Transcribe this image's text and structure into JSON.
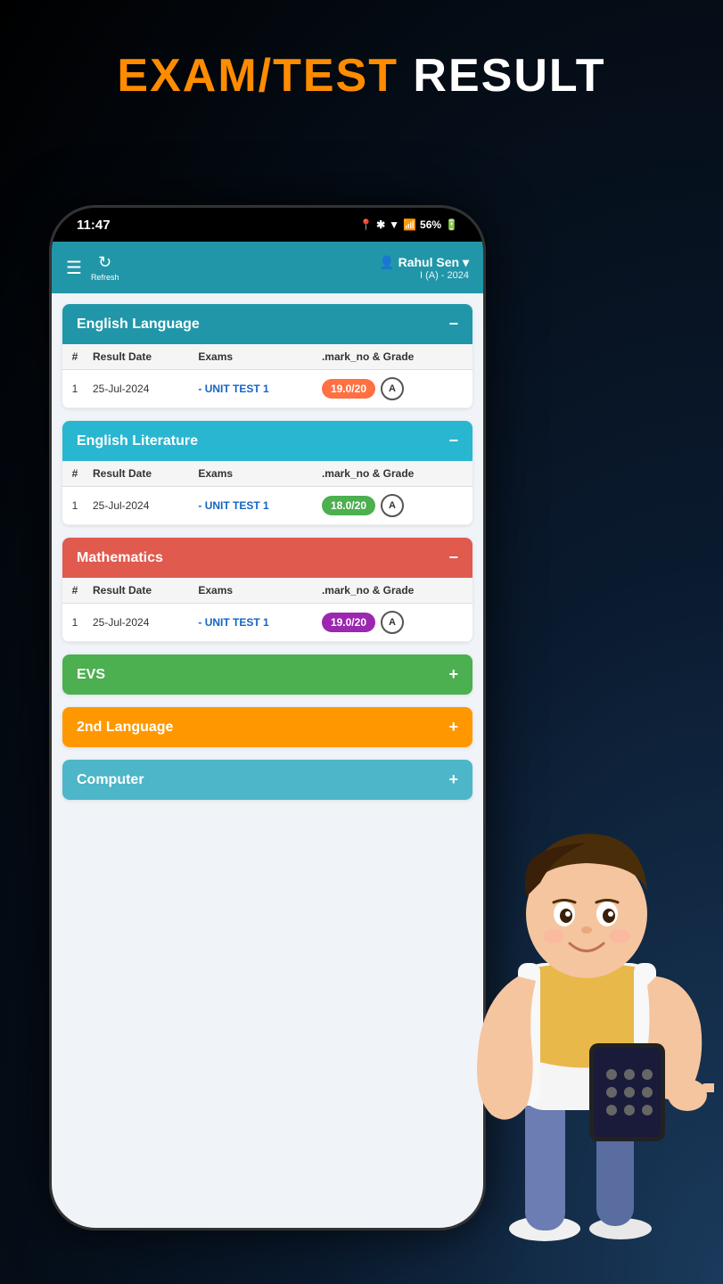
{
  "page": {
    "title_orange": "EXAM/TEST",
    "title_white": " RESULT"
  },
  "status_bar": {
    "time": "11:47",
    "battery": "56%"
  },
  "header": {
    "refresh_label": "Refresh",
    "user_icon": "👤",
    "user_name": "Rahul Sen",
    "user_class": "I (A) - 2024"
  },
  "subjects": [
    {
      "id": "english-language",
      "name": "English Language",
      "color": "blue",
      "toggle": "−",
      "expanded": true,
      "columns": [
        "#",
        "Result Date",
        "Exams",
        ".mark_no & Grade"
      ],
      "rows": [
        {
          "num": 1,
          "date": "25-Jul-2024",
          "exam": "- UNIT TEST 1",
          "marks": "19.0/20",
          "marks_color": "orange-bg",
          "grade": "A"
        }
      ]
    },
    {
      "id": "english-literature",
      "name": "English Literature",
      "color": "light-blue",
      "toggle": "−",
      "expanded": true,
      "columns": [
        "#",
        "Result Date",
        "Exams",
        ".mark_no & Grade"
      ],
      "rows": [
        {
          "num": 1,
          "date": "25-Jul-2024",
          "exam": "- UNIT TEST 1",
          "marks": "18.0/20",
          "marks_color": "green-bg",
          "grade": "A"
        }
      ]
    },
    {
      "id": "mathematics",
      "name": "Mathematics",
      "color": "red",
      "toggle": "−",
      "expanded": true,
      "columns": [
        "#",
        "Result Date",
        "Exams",
        ".mark_no & Grade"
      ],
      "rows": [
        {
          "num": 1,
          "date": "25-Jul-2024",
          "exam": "- UNIT TEST 1",
          "marks": "19.0/20",
          "marks_color": "purple-bg",
          "grade": "A"
        }
      ]
    },
    {
      "id": "evs",
      "name": "EVS",
      "color": "green",
      "toggle": "+",
      "expanded": false
    },
    {
      "id": "2nd-language",
      "name": "2nd Language",
      "color": "orange",
      "toggle": "+",
      "expanded": false
    },
    {
      "id": "computer",
      "name": "Computer",
      "color": "teal",
      "toggle": "+",
      "expanded": false
    }
  ],
  "icons": {
    "hamburger": "☰",
    "refresh": "↻",
    "minus": "−",
    "plus": "+"
  }
}
